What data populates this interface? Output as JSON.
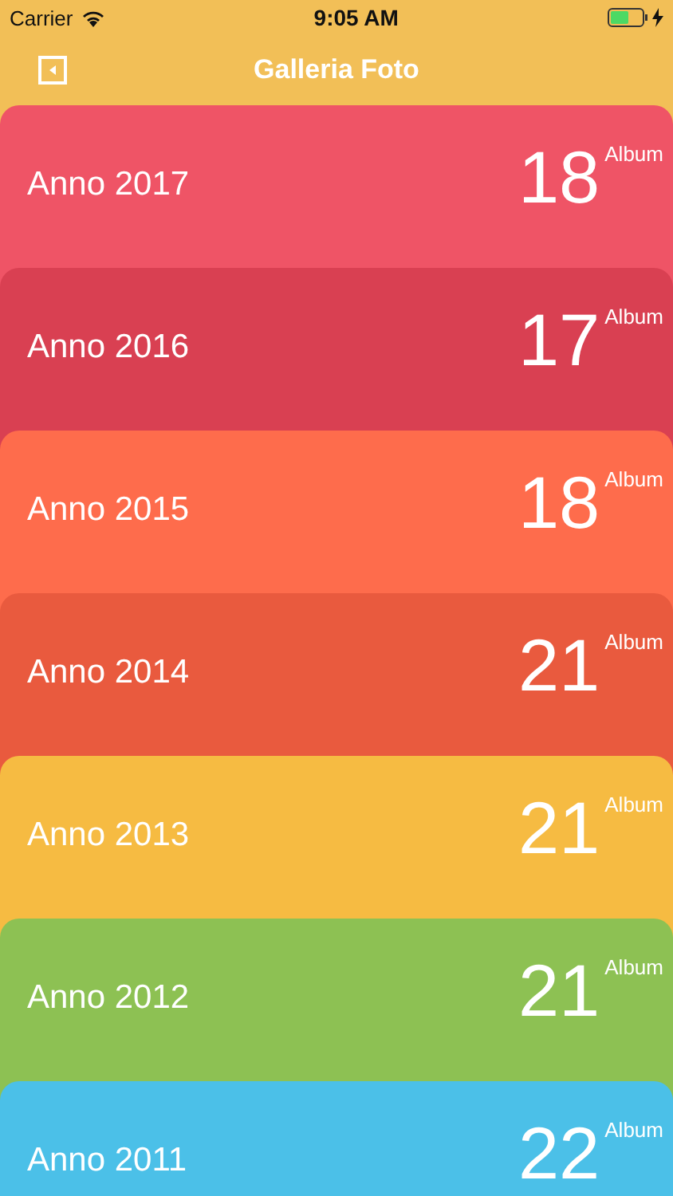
{
  "status_bar": {
    "carrier": "Carrier",
    "time": "9:05 AM"
  },
  "nav": {
    "title": "Galleria Foto"
  },
  "albums": [
    {
      "label": "Anno 2017",
      "count": "18",
      "unit": "Album",
      "color": "#ef5466"
    },
    {
      "label": "Anno 2016",
      "count": "17",
      "unit": "Album",
      "color": "#d94052"
    },
    {
      "label": "Anno 2015",
      "count": "18",
      "unit": "Album",
      "color": "#fe6c4c"
    },
    {
      "label": "Anno 2014",
      "count": "21",
      "unit": "Album",
      "color": "#e95a3e"
    },
    {
      "label": "Anno 2013",
      "count": "21",
      "unit": "Album",
      "color": "#f6bb42"
    },
    {
      "label": "Anno 2012",
      "count": "21",
      "unit": "Album",
      "color": "#8dc153"
    },
    {
      "label": "Anno 2011",
      "count": "22",
      "unit": "Album",
      "color": "#4bc0e8"
    }
  ]
}
